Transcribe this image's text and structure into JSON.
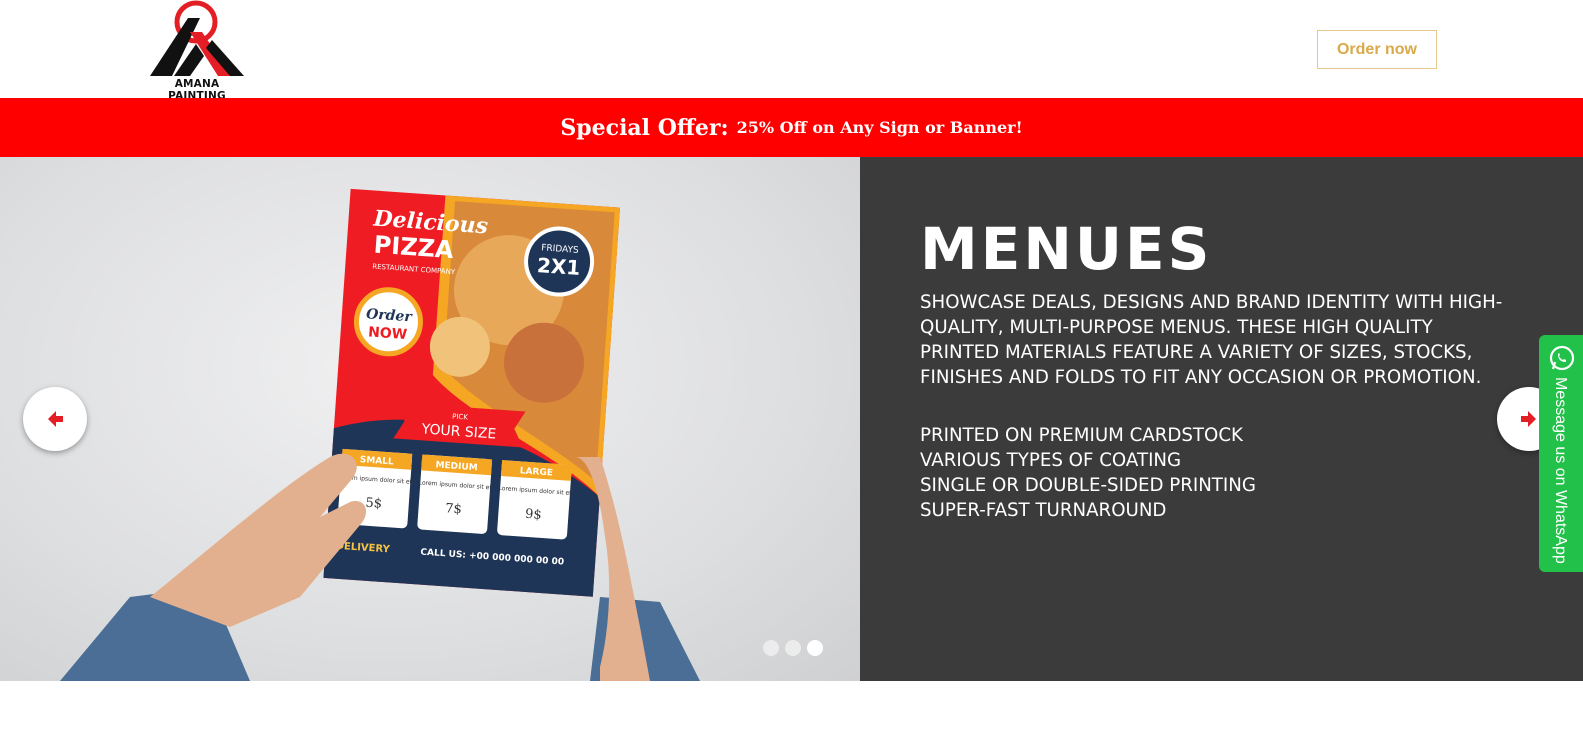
{
  "brand": {
    "name": "AMANA PAINTING",
    "logo_icon": "amana-logo-icon"
  },
  "header": {
    "order_button_label": "Order now"
  },
  "offer": {
    "lead": "Special Offer:",
    "text": "25% Off on Any Sign or Banner!"
  },
  "slider": {
    "title": "MENUES",
    "description": "Showcase deals, designs and brand identity with high-quality, multi-purpose menus. These high quality printed materials feature a variety of sizes, stocks, finishes and folds to fit any occasion or promotion.",
    "features": [
      "Printed on premium cardstock",
      "Various types of coating",
      "Single or double-sided printing",
      "Super-fast turnaround"
    ],
    "slides_total": 3,
    "active_slide": 3,
    "prev_icon": "arrow-left-icon",
    "next_icon": "arrow-right-icon"
  },
  "flyer": {
    "title_line1": "Delicious",
    "title_line2": "PIZZA",
    "subtitle": "RESTAURANT COMPANY",
    "badge_top": "FRIDAYS",
    "badge_main": "2X1",
    "order_line1": "Order",
    "order_line2": "NOW",
    "pick": "PICK",
    "size_banner": "YOUR SIZE",
    "sizes": [
      {
        "name": "SMALL",
        "text": "Lorem ipsum dolor sit et",
        "price": "5$"
      },
      {
        "name": "MEDIUM",
        "text": "Lorem ipsum dolor sit et",
        "price": "7$"
      },
      {
        "name": "LARGE",
        "text": "Lorem ipsum dolor sit et",
        "price": "9$"
      }
    ],
    "delivery": "DELIVERY",
    "call": "CALL US: +00 000 000 00 00"
  },
  "whatsapp": {
    "label": "Message us on WhatsApp",
    "icon": "whatsapp-icon"
  },
  "colors": {
    "accent_red": "#ff0000",
    "order_gold": "#d9a94a",
    "panel_dark": "#3b3b3b",
    "whatsapp_green": "#22c24a"
  }
}
